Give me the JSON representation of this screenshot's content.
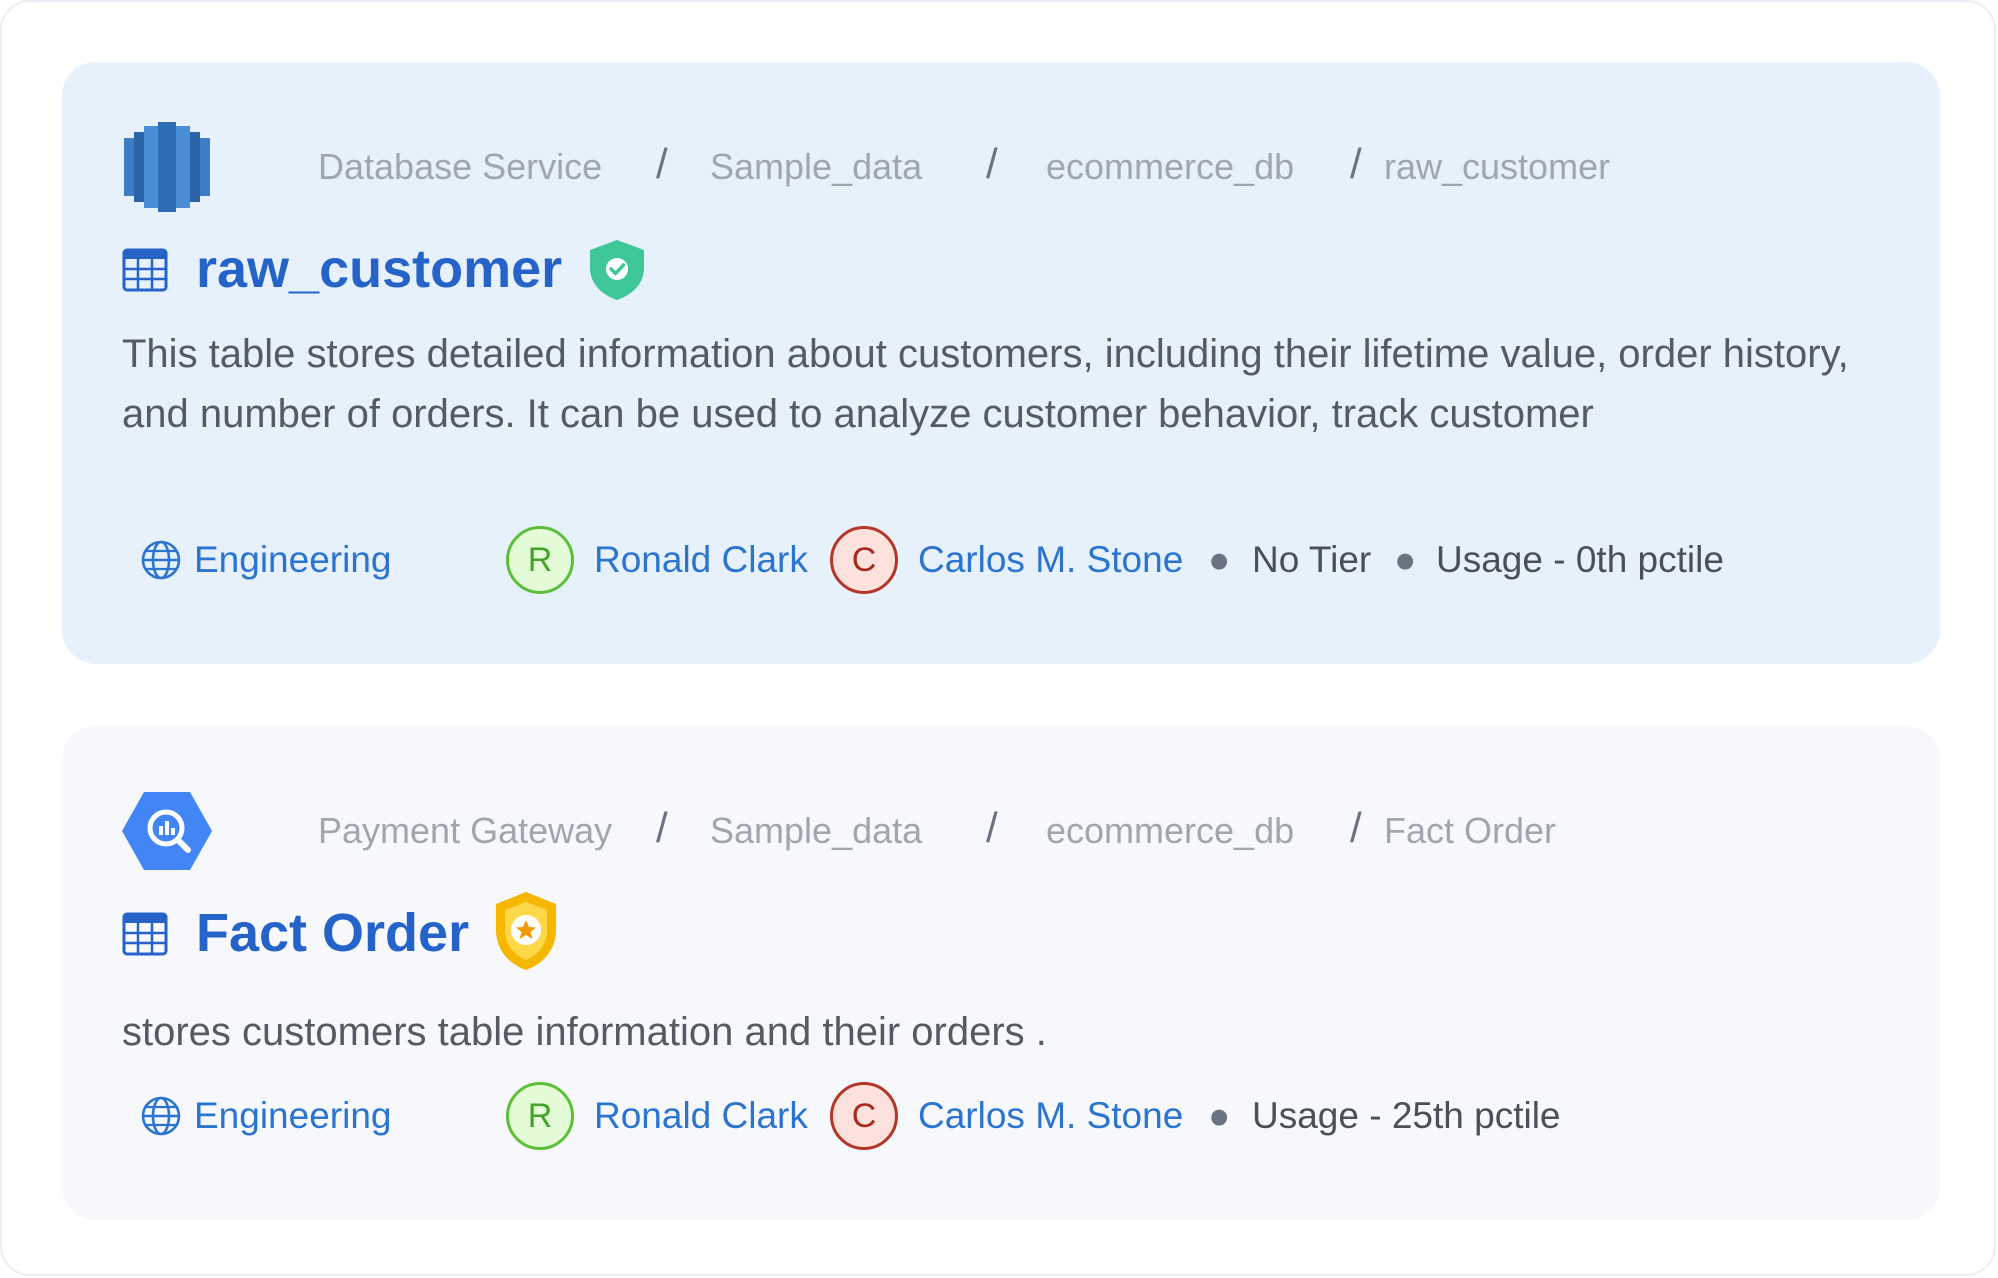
{
  "cards": [
    {
      "service_icon": "redshift-icon",
      "breadcrumb": [
        "Database Service",
        "Sample_data",
        "ecommerce_db",
        "raw_customer"
      ],
      "separator": "/",
      "entity_icon": "table-icon",
      "title": "raw_customer",
      "badge": "verified-shield-icon",
      "description": "This table stores detailed information about customers, including their lifetime value, order history, and number of orders. It can be used to analyze customer behavior, track customer",
      "domain": "Engineering",
      "owners": [
        {
          "initial": "R",
          "name": "Ronald Clark",
          "color": "#5bbf3a"
        },
        {
          "initial": "C",
          "name": "Carlos M. Stone",
          "color": "#b3362a"
        }
      ],
      "tier": "No Tier",
      "usage": "Usage - 0th pctile"
    },
    {
      "service_icon": "bigquery-icon",
      "breadcrumb": [
        "Payment Gateway",
        "Sample_data",
        "ecommerce_db",
        "Fact Order"
      ],
      "separator": "/",
      "entity_icon": "table-icon",
      "title": "Fact Order",
      "badge": "gold-star-shield-icon",
      "description": "stores customers table information and their orders .",
      "domain": "Engineering",
      "owners": [
        {
          "initial": "R",
          "name": "Ronald Clark",
          "color": "#5bbf3a"
        },
        {
          "initial": "C",
          "name": "Carlos M. Stone",
          "color": "#b3362a"
        }
      ],
      "usage": "Usage - 25th pctile"
    }
  ],
  "colors": {
    "accent": "#2563c9",
    "card_selected_bg": "#e7f1fc",
    "card_bg": "#f6f8fc",
    "verified": "#3fc79a",
    "gold": "#f5b700"
  }
}
